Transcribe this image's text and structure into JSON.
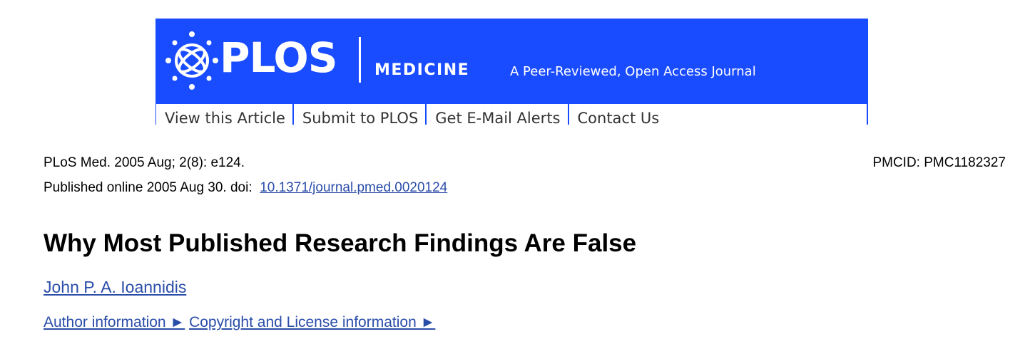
{
  "header": {
    "logo_text": "PLOS",
    "journal": "MEDICINE",
    "tagline": "A Peer-Reviewed, Open Access Journal",
    "brand_color": "#1a4cff",
    "nav": [
      {
        "label": "View this Article"
      },
      {
        "label": "Submit to PLOS"
      },
      {
        "label": "Get E-Mail Alerts"
      },
      {
        "label": "Contact Us"
      }
    ]
  },
  "article": {
    "citation": "PLoS Med. 2005 Aug; 2(8): e124.",
    "pmcid": "PMCID: PMC1182327",
    "published_prefix": "Published online 2005 Aug 30. doi:",
    "doi": "10.1371/journal.pmed.0020124",
    "title": "Why Most Published Research Findings Are False",
    "author": "John P. A. Ioannidis",
    "author_info": "Author information ►",
    "copyright_info": "Copyright and License information ►",
    "link_color": "#2a4da8"
  }
}
